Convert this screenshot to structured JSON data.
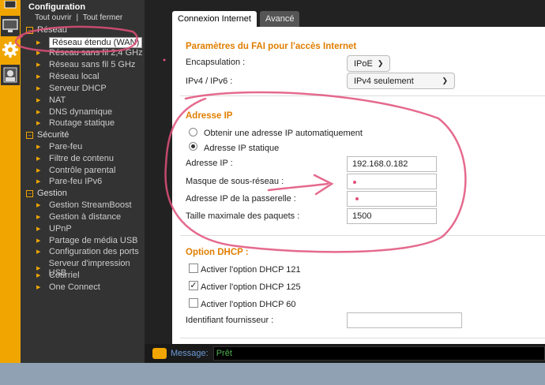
{
  "nav": {
    "title": "Configuration",
    "open_all": "Tout ouvrir",
    "divider": "|",
    "close_all": "Tout fermer",
    "sections": [
      {
        "label": "Réseau",
        "items": [
          "Réseau étendu (WAN)",
          "Réseau sans fil 2,4 GHz",
          "Réseau sans fil 5 GHz",
          "Réseau local",
          "Serveur DHCP",
          "NAT",
          "DNS dynamique",
          "Routage statique"
        ]
      },
      {
        "label": "Sécurité",
        "items": [
          "Pare-feu",
          "Filtre de contenu",
          "Contrôle parental",
          "Pare-feu IPv6"
        ]
      },
      {
        "label": "Gestion",
        "items": [
          "Gestion StreamBoost",
          "Gestion à distance",
          "UPnP",
          "Partage de média USB",
          "Configuration des ports",
          "Serveur d'impression USB",
          "Courriel",
          "One Connect"
        ]
      }
    ]
  },
  "tabs": [
    "Connexion Internet",
    "Avancé"
  ],
  "isp": {
    "heading": "Paramètres du FAI pour l'accès Internet",
    "encapsulation_label": "Encapsulation :",
    "encapsulation_value": "IPoE",
    "ipv_label": "IPv4 / IPv6 :",
    "ipv_value": "IPv4 seulement"
  },
  "ip": {
    "heading": "Adresse IP",
    "auto_label": "Obtenir une adresse IP automatiquement",
    "static_label": "Adresse IP statique",
    "address_label": "Adresse IP :",
    "address_value": "192.168.0.182",
    "mask_label": "Masque de sous-réseau :",
    "gateway_label": "Adresse IP de la passerelle :",
    "mtu_label": "Taille maximale des paquets :",
    "mtu_value": "1500"
  },
  "dhcp": {
    "heading": "Option DHCP :",
    "opt121": "Activer l'option DHCP 121",
    "opt125": "Activer l'option DHCP 125",
    "opt60": "Activer l'option DHCP 60",
    "vendor_label": "Identifiant fournisseur :"
  },
  "status": {
    "label": "Message:",
    "value": "Prêt"
  },
  "colors": {
    "accent": "#f0a500",
    "heading": "#e07e00",
    "annotation": "#e0507a"
  }
}
